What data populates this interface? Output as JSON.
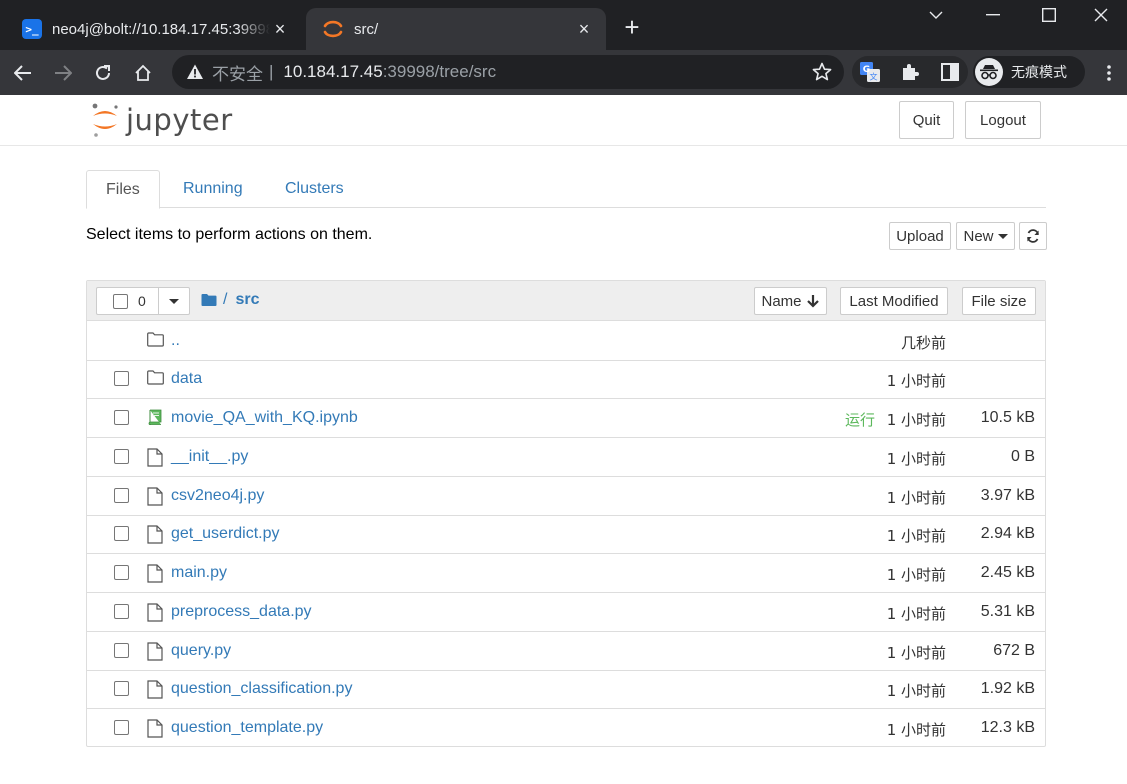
{
  "browser": {
    "tabs": [
      {
        "title": "neo4j@bolt://10.184.17.45:39998",
        "favicon": "terminal-icon",
        "active": false
      },
      {
        "title": "src/",
        "favicon": "jupyter-icon",
        "active": true
      }
    ],
    "address": {
      "insecure_label": "不安全",
      "separator": "|",
      "host": "10.184.17.45",
      "path": ":39998/tree/src"
    },
    "profile_label": "无痕模式",
    "colors": {
      "tabstrip": "#202124",
      "toolbar": "#35363a"
    }
  },
  "header": {
    "logo_text": "jupyter",
    "quit_label": "Quit",
    "logout_label": "Logout"
  },
  "tabs": [
    {
      "label": "Files",
      "active": true
    },
    {
      "label": "Running",
      "active": false
    },
    {
      "label": "Clusters",
      "active": false
    }
  ],
  "toolbar": {
    "message": "Select items to perform actions on them.",
    "upload_label": "Upload",
    "new_label": "New"
  },
  "list_header": {
    "selected_count": "0",
    "breadcrumb_sep": "/",
    "breadcrumb_dir": "src",
    "sort_name_label": "Name",
    "sort_modified_label": "Last Modified",
    "sort_size_label": "File size"
  },
  "files": [
    {
      "name": "..",
      "type": "folder",
      "status": "",
      "modified": "几秒前",
      "size": "",
      "checkbox": false
    },
    {
      "name": "data",
      "type": "folder",
      "status": "",
      "modified": "1 小时前",
      "size": "",
      "checkbox": true
    },
    {
      "name": "movie_QA_with_KQ.ipynb",
      "type": "notebook",
      "status": "运行",
      "modified": "1 小时前",
      "size": "10.5 kB",
      "checkbox": true
    },
    {
      "name": "__init__.py",
      "type": "file",
      "status": "",
      "modified": "1 小时前",
      "size": "0 B",
      "checkbox": true
    },
    {
      "name": "csv2neo4j.py",
      "type": "file",
      "status": "",
      "modified": "1 小时前",
      "size": "3.97 kB",
      "checkbox": true
    },
    {
      "name": "get_userdict.py",
      "type": "file",
      "status": "",
      "modified": "1 小时前",
      "size": "2.94 kB",
      "checkbox": true
    },
    {
      "name": "main.py",
      "type": "file",
      "status": "",
      "modified": "1 小时前",
      "size": "2.45 kB",
      "checkbox": true
    },
    {
      "name": "preprocess_data.py",
      "type": "file",
      "status": "",
      "modified": "1 小时前",
      "size": "5.31 kB",
      "checkbox": true
    },
    {
      "name": "query.py",
      "type": "file",
      "status": "",
      "modified": "1 小时前",
      "size": "672 B",
      "checkbox": true
    },
    {
      "name": "question_classification.py",
      "type": "file",
      "status": "",
      "modified": "1 小时前",
      "size": "1.92 kB",
      "checkbox": true
    },
    {
      "name": "question_template.py",
      "type": "file",
      "status": "",
      "modified": "1 小时前",
      "size": "12.3 kB",
      "checkbox": true
    }
  ],
  "colors": {
    "link": "#337ab7",
    "running": "#5cb85c",
    "jupyter_orange": "#f37726"
  }
}
